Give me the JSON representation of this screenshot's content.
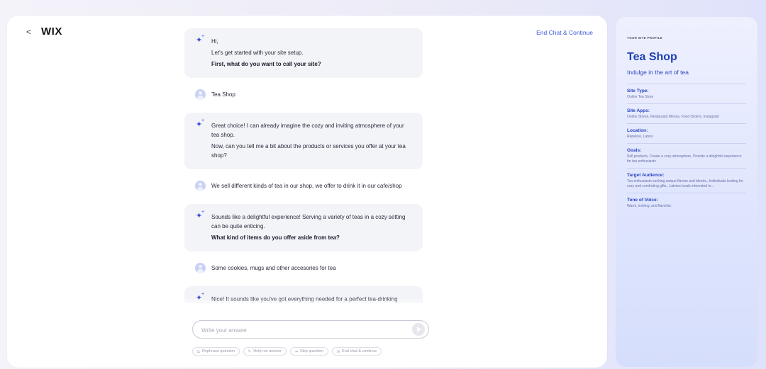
{
  "header": {
    "back_icon": "chevron-left-icon",
    "back_glyph": "<",
    "logo": "WIX",
    "end_chat": "End Chat & Continue"
  },
  "chat": {
    "messages": [
      {
        "role": "bot",
        "lines": [
          {
            "text": "Hi,",
            "bold": false
          },
          {
            "text": "Let's get started with your site setup.",
            "bold": false
          },
          {
            "text": "First, what do you want to call your site?",
            "bold": true
          }
        ]
      },
      {
        "role": "user",
        "text": "Tea Shop"
      },
      {
        "role": "bot",
        "lines": [
          {
            "text": "Great choice! I can already imagine the cozy and inviting atmosphere of your tea shop.",
            "bold": false
          },
          {
            "text": "Now, can you tell me a bit about the products or services you offer at your tea shop?",
            "bold": false
          }
        ]
      },
      {
        "role": "user",
        "text": "We sell different kinds of tea in our shop, we offer to drink it in our cafe/shop"
      },
      {
        "role": "bot",
        "lines": [
          {
            "text": "Sounds like a delightful experience! Serving a variety of teas in a cozy setting can be quite enticing.",
            "bold": false
          },
          {
            "text": "What kind of items do you offer aside from tea?",
            "bold": true
          }
        ]
      },
      {
        "role": "user",
        "text": "Some cookies, mugs and other accesories for tea"
      },
      {
        "role": "bot",
        "lines": [
          {
            "text": "Nice! It sounds like you've got everything needed for a perfect tea-drinking experience.",
            "bold": false
          }
        ]
      }
    ]
  },
  "input": {
    "placeholder": "Write your answer",
    "send_icon": "send-arrow-icon"
  },
  "actions": [
    {
      "icon": "rephrase-icon",
      "glyph": "⇆",
      "label": "Rephrase question"
    },
    {
      "icon": "help-icon",
      "glyph": "✎",
      "label": "Help me answer"
    },
    {
      "icon": "skip-icon",
      "glyph": "⇥",
      "label": "Skip question"
    },
    {
      "icon": "exit-icon",
      "glyph": "⇲",
      "label": "End chat & continue"
    }
  ],
  "profile": {
    "kicker": "YOUR SITE PROFILE",
    "title": "Tea Shop",
    "tagline": "Indulge in the art of tea",
    "sections": [
      {
        "label": "Site Type:",
        "value": "Online Tea Store"
      },
      {
        "label": "Site Apps:",
        "value": "Online Stores, Restaurant Menus, Food Orders, Instagram"
      },
      {
        "label": "Location:",
        "value": "Repekne, Latvia"
      },
      {
        "label": "Goals:",
        "value": "Sell products, Create a cozy atmosphere, Provide a delightful experience for tea enthusiasts"
      },
      {
        "label": "Target Audience:",
        "value": "Tea enthusiasts seeking unique flavors and blends., Individuals looking for cozy and comforting gifts., Latvian locals interested in..."
      },
      {
        "label": "Tone of Voice:",
        "value": "Warm, inviting, and flavorful."
      }
    ]
  },
  "colors": {
    "accent": "#3d4bd6",
    "link": "#3b5bdb",
    "profile_title": "#1f3fb5"
  }
}
